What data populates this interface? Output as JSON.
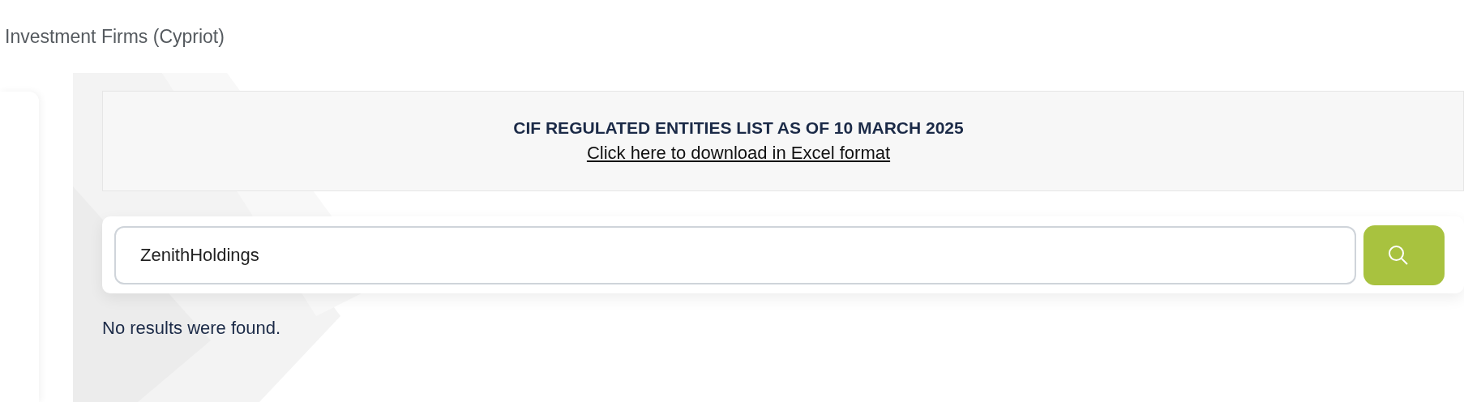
{
  "breadcrumb": "Investment Firms (Cypriot)",
  "banner": {
    "title": "CIF REGULATED ENTITIES LIST AS OF 10 MARCH 2025",
    "link": "Click here to download in Excel format"
  },
  "search": {
    "value": "ZenithHoldings"
  },
  "message": "No results were found."
}
